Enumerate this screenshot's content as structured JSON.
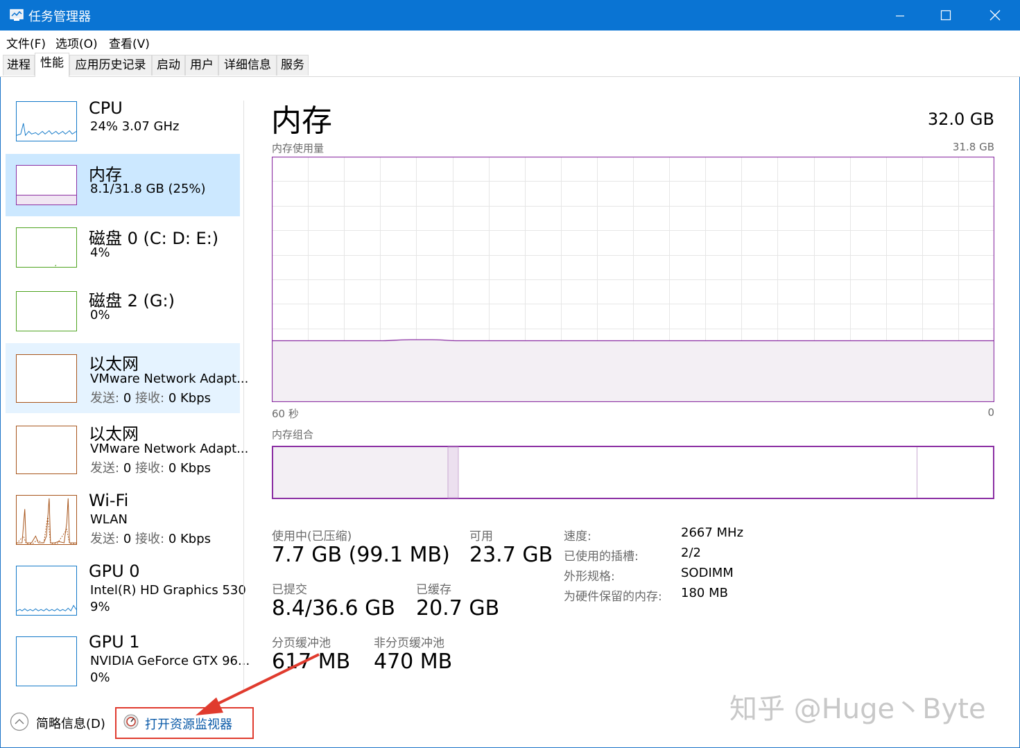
{
  "window": {
    "title": "任务管理器"
  },
  "menu": [
    "文件(F)",
    "选项(O)",
    "查看(V)"
  ],
  "tabs": [
    {
      "label": "进程",
      "active": false
    },
    {
      "label": "性能",
      "active": true
    },
    {
      "label": "应用历史记录",
      "active": false
    },
    {
      "label": "启动",
      "active": false
    },
    {
      "label": "用户",
      "active": false
    },
    {
      "label": "详细信息",
      "active": false
    },
    {
      "label": "服务",
      "active": false
    }
  ],
  "sidebar": [
    {
      "title": "CPU",
      "line1": "24%  3.07 GHz",
      "line2": "",
      "color": "#1178c8"
    },
    {
      "title": "内存",
      "line1": "8.1/31.8 GB (25%)",
      "line2": "",
      "color": "#8b2fa3"
    },
    {
      "title": "磁盘 0 (C: D: E:)",
      "line1": "4%",
      "line2": "",
      "color": "#4da31f"
    },
    {
      "title": "磁盘 2 (G:)",
      "line1": "0%",
      "line2": "",
      "color": "#4da31f"
    },
    {
      "title": "以太网",
      "line1": "VMware Network Adapt...",
      "line2_k1": "发送:",
      "line2_v1": "0",
      "line2_k2": "接收:",
      "line2_v2": "0 Kbps",
      "color": "#a7541a"
    },
    {
      "title": "以太网",
      "line1": "VMware Network Adapt...",
      "line2_k1": "发送:",
      "line2_v1": "0",
      "line2_k2": "接收:",
      "line2_v2": "0 Kbps",
      "color": "#a7541a"
    },
    {
      "title": "Wi-Fi",
      "line1": "WLAN",
      "line2_k1": "发送:",
      "line2_v1": "0",
      "line2_k2": "接收:",
      "line2_v2": "0 Kbps",
      "color": "#a7541a"
    },
    {
      "title": "GPU 0",
      "line1": "Intel(R) HD Graphics 530",
      "line2": "9%",
      "color": "#1178c8"
    },
    {
      "title": "GPU 1",
      "line1": "NVIDIA GeForce GTX 96...",
      "line2": "0%",
      "color": "#1178c8"
    }
  ],
  "main": {
    "title": "内存",
    "total": "32.0 GB",
    "usage_label": "内存使用量",
    "usage_max": "31.8 GB",
    "axis_left": "60 秒",
    "axis_right": "0",
    "usage_fraction": 0.25,
    "composition_label": "内存组合",
    "stats": {
      "in_use_label": "使用中(已压缩)",
      "in_use_value": "7.7 GB (99.1 MB)",
      "available_label": "可用",
      "available_value": "23.7 GB",
      "committed_label": "已提交",
      "committed_value": "8.4/36.6 GB",
      "cached_label": "已缓存",
      "cached_value": "20.7 GB",
      "paged_label": "分页缓冲池",
      "paged_value": "617 MB",
      "nonpaged_label": "非分页缓冲池",
      "nonpaged_value": "470 MB"
    },
    "info": [
      {
        "k": "速度:",
        "v": "2667 MHz"
      },
      {
        "k": "已使用的插槽:",
        "v": "2/2"
      },
      {
        "k": "外形规格:",
        "v": "SODIMM"
      },
      {
        "k": "为硬件保留的内存:",
        "v": "180 MB"
      }
    ],
    "accent": "#8b2fa3"
  },
  "bottom": {
    "fewer_details": "简略信息(D)",
    "resource_monitor": "打开资源监视器"
  },
  "watermark": "知乎 @Huge丶Byte"
}
